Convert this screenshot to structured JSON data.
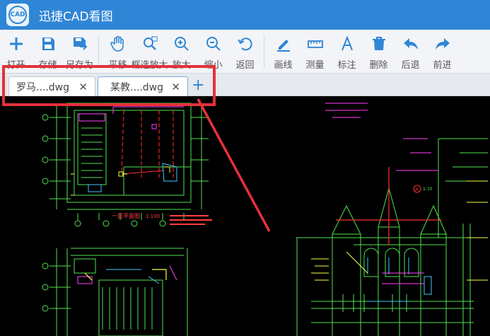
{
  "app": {
    "title": "迅捷CAD看图",
    "logo_text": "CAD",
    "accent": "#2f86d6"
  },
  "toolbar": {
    "items": [
      {
        "label": "打开",
        "icon": "plus-icon"
      },
      {
        "label": "存储",
        "icon": "save-icon"
      },
      {
        "label": "另存为",
        "icon": "save-as-icon"
      },
      {
        "label": "平移",
        "icon": "hand-icon"
      },
      {
        "label": "框选放大",
        "icon": "zoom-window-icon"
      },
      {
        "label": "放大",
        "icon": "zoom-in-icon"
      },
      {
        "label": "缩小",
        "icon": "zoom-out-icon"
      },
      {
        "label": "返回",
        "icon": "back-icon"
      },
      {
        "label": "画线",
        "icon": "pencil-icon"
      },
      {
        "label": "测量",
        "icon": "ruler-icon"
      },
      {
        "label": "标注",
        "icon": "text-a-icon"
      },
      {
        "label": "删除",
        "icon": "trash-icon"
      },
      {
        "label": "后退",
        "icon": "undo-arrow-icon"
      },
      {
        "label": "前进",
        "icon": "redo-arrow-icon"
      }
    ]
  },
  "tabs": [
    {
      "name": "罗马....dwg",
      "close": "✕"
    },
    {
      "name": "某教....dwg",
      "close": "✕"
    }
  ],
  "tab_add": "+",
  "annotation_color": "#e5303b",
  "drawing": {
    "plan_title": "一层平面图",
    "plan_scale": "1:100",
    "marker_label": "A",
    "marker_scale": "1:10"
  }
}
